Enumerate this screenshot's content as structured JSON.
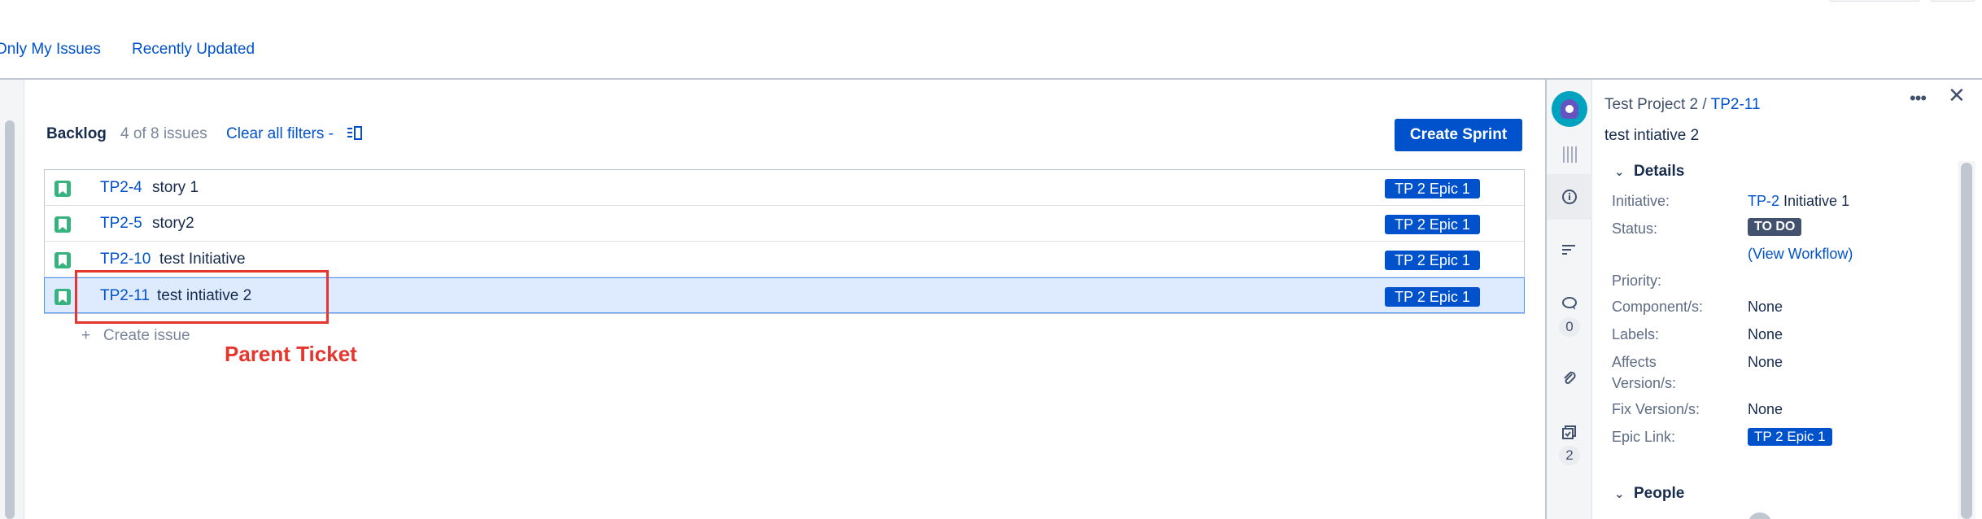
{
  "quick_filters": [
    "Only My Issues",
    "Recently Updated"
  ],
  "backlog": {
    "title": "Backlog",
    "count_text": "4 of 8 issues",
    "clear_filters_label": "Clear all filters",
    "create_sprint_label": "Create Sprint",
    "create_issue_label": "+   Create issue",
    "issues": [
      {
        "key": "TP2-4",
        "summary": "story 1",
        "epic": "TP 2 Epic 1",
        "type_icon": "story-icon"
      },
      {
        "key": "TP2-5",
        "summary": "story2",
        "epic": "TP 2 Epic 1",
        "type_icon": "story-icon"
      },
      {
        "key": "TP2-10",
        "summary": "test Initiative",
        "epic": "TP 2 Epic 1",
        "type_icon": "story-icon"
      },
      {
        "key": "TP2-11",
        "summary": "test intiative 2",
        "epic": "TP 2 Epic 1",
        "type_icon": "story-icon",
        "selected": true
      }
    ]
  },
  "annotation": {
    "label": "Parent Ticket",
    "color": "#e5352c"
  },
  "detail_panel": {
    "project": "Test Project 2",
    "separator": "/",
    "issue_key": "TP2-11",
    "title": "test intiative 2",
    "comment_count": "0",
    "subtask_count": "2",
    "details_heading": "Details",
    "people_heading": "People",
    "fields": {
      "initiative_label": "Initiative:",
      "initiative_key": "TP-2",
      "initiative_name": "Initiative 1",
      "status_label": "Status:",
      "status_value": "TO DO",
      "view_workflow": "(View Workflow)",
      "priority_label": "Priority:",
      "components_label": "Component/s:",
      "components_value": "None",
      "labels_label": "Labels:",
      "labels_value": "None",
      "affects_label_1": "Affects",
      "affects_label_2": "Version/s:",
      "affects_value": "None",
      "fix_label": "Fix Version/s:",
      "fix_value": "None",
      "epic_link_label": "Epic Link:",
      "epic_link_value": "TP 2 Epic 1"
    }
  },
  "colors": {
    "accent": "#0052cc",
    "story": "#36b37e",
    "selected_row": "#deebff",
    "status": "#42526e"
  }
}
